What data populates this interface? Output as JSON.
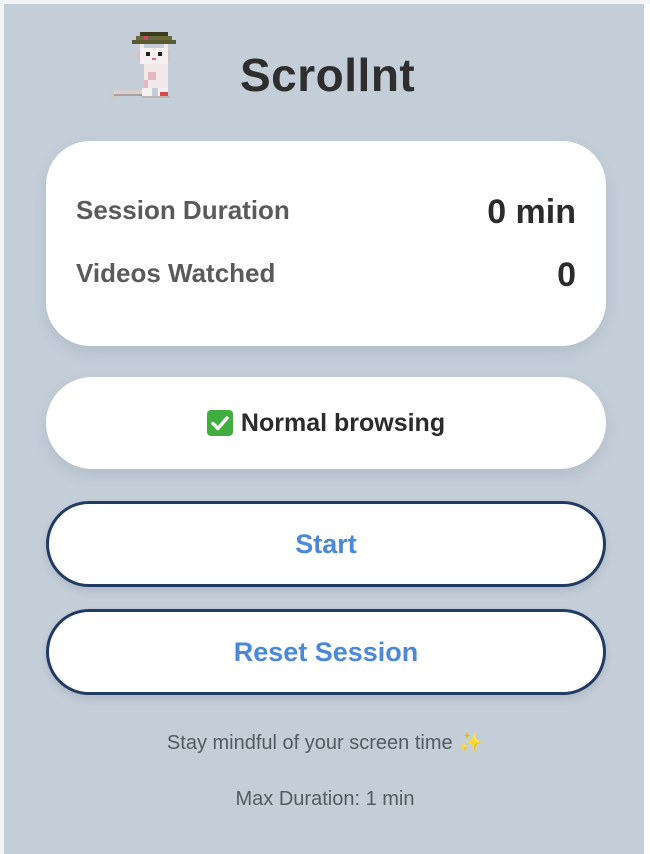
{
  "app": {
    "title": "Scrollnt",
    "logo_icon": "pixel-cat-icon"
  },
  "stats": {
    "session_duration_label": "Session Duration",
    "session_duration_value": "0 min",
    "videos_watched_label": "Videos Watched",
    "videos_watched_value": "0"
  },
  "status": {
    "icon": "checkmark-icon",
    "text": "Normal browsing"
  },
  "buttons": {
    "start_label": "Start",
    "reset_label": "Reset Session"
  },
  "footer": {
    "tip": "Stay mindful of your screen time",
    "tip_icon": "sparkles-icon",
    "max_duration": "Max Duration: 1 min"
  },
  "colors": {
    "background": "#c4ced9",
    "button_text": "#4b88d8",
    "button_border": "#223b63",
    "status_check": "#3fae3f"
  }
}
